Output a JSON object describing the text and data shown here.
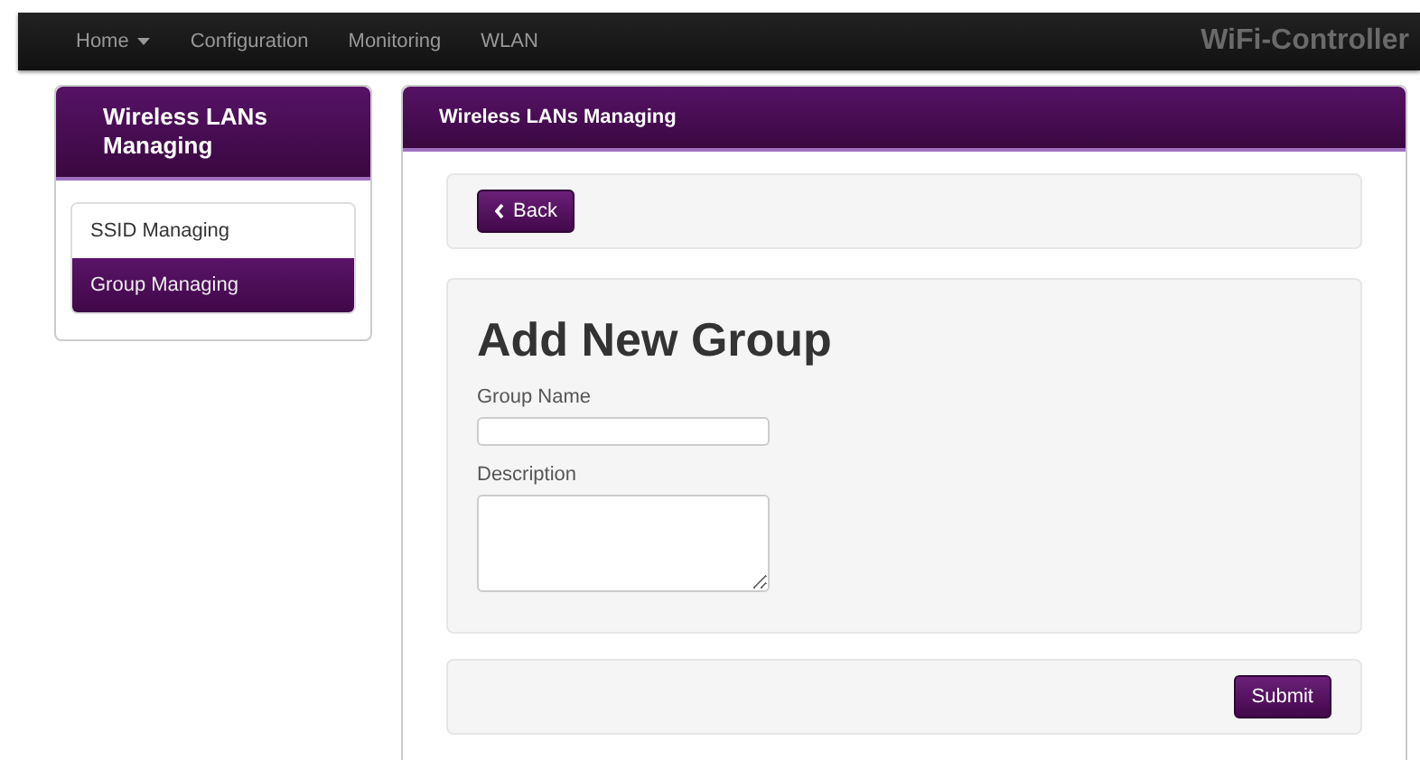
{
  "navbar": {
    "items": [
      {
        "label": "Home",
        "dropdown": true
      },
      {
        "label": "Configuration",
        "dropdown": false
      },
      {
        "label": "Monitoring",
        "dropdown": false
      },
      {
        "label": "WLAN",
        "dropdown": false
      }
    ],
    "brand": "WiFi-Controller"
  },
  "sidebar": {
    "title": "Wireless LANs Managing",
    "items": [
      {
        "label": "SSID Managing",
        "selected": false
      },
      {
        "label": "Group Managing",
        "selected": true
      }
    ]
  },
  "panel": {
    "title": "Wireless LANs Managing",
    "back_button": "Back",
    "heading": "Add New Group",
    "fields": [
      {
        "kind": "input",
        "label": "Group Name"
      },
      {
        "kind": "textarea",
        "label": "Description"
      }
    ],
    "submit_button": "Submit"
  }
}
